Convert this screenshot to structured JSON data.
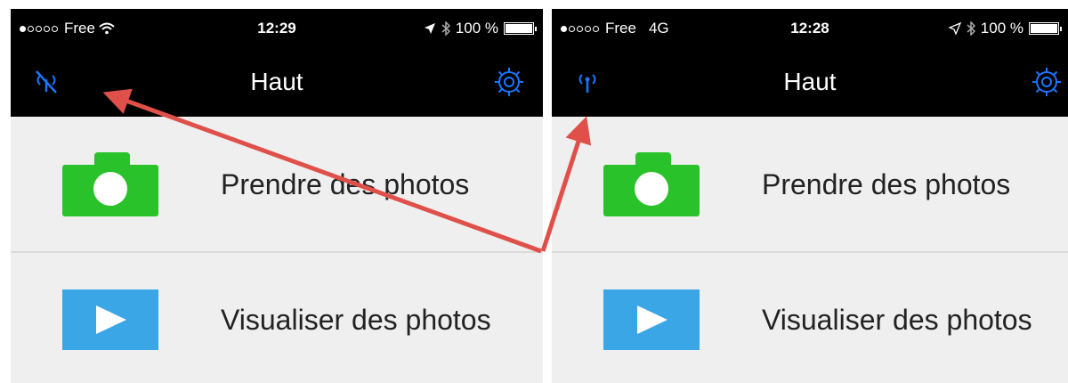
{
  "colors": {
    "nav_bar": "#000000",
    "accent_blue": "#1976ff",
    "camera_green": "#2ac22a",
    "play_blue": "#3aa6e6",
    "arrow_red": "#e0504a",
    "row_bg": "#efefef"
  },
  "screens": [
    {
      "status": {
        "carrier": "Free",
        "network": "wifi",
        "time": "12:29",
        "battery": "100 %"
      },
      "nav": {
        "title": "Haut",
        "left_icon": "antenna-off-icon",
        "right_icon": "gear-icon"
      },
      "rows": [
        {
          "label": "Prendre des photos",
          "icon": "camera-icon"
        },
        {
          "label": "Visualiser des photos",
          "icon": "play-icon"
        }
      ]
    },
    {
      "status": {
        "carrier": "Free",
        "network": "4G",
        "time": "12:28",
        "battery": "100 %"
      },
      "nav": {
        "title": "Haut",
        "left_icon": "antenna-on-icon",
        "right_icon": "gear-icon"
      },
      "rows": [
        {
          "label": "Prendre des photos",
          "icon": "camera-icon"
        },
        {
          "label": "Visualiser des photos",
          "icon": "play-icon"
        }
      ]
    }
  ]
}
